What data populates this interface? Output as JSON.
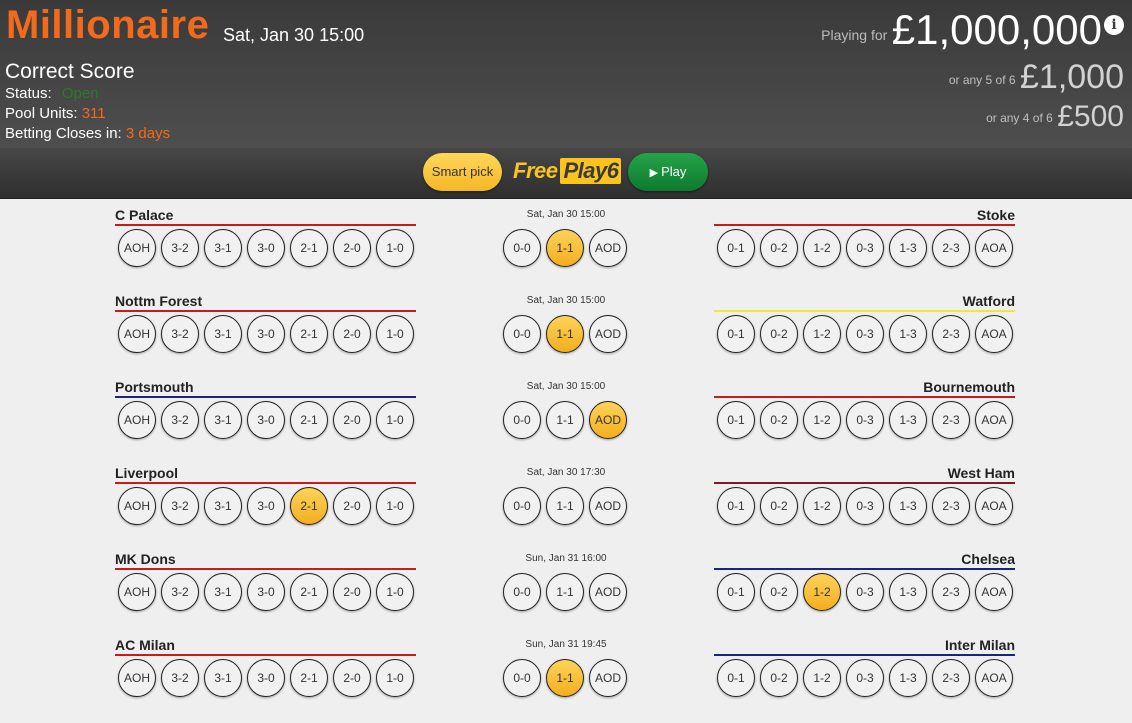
{
  "header": {
    "title": "Millionaire",
    "date": "Sat, Jan 30 15:00",
    "game_name": "Correct Score",
    "status_label": "Status:",
    "status_value": "Open",
    "pool_label": "Pool Units:",
    "pool_value": "311",
    "closes_label": "Betting Closes in:",
    "closes_value": "3 days",
    "jackpot_prefix": "Playing for",
    "jackpot_amount": "£1,000,000",
    "info_icon": "i",
    "prize2_prefix": "or any 5 of 6",
    "prize2_amount": "£1,000",
    "prize3_prefix": "or any 4 of 6",
    "prize3_amount": "£500"
  },
  "actions": {
    "smart_pick_label": "Smart pick",
    "freeplay_text": "Free",
    "freeplay_box": "Play6",
    "play_icon": "▶",
    "play_label": "Play"
  },
  "colors": {
    "brand_orange": "#f26a1b",
    "status_green": "#2a7a2a",
    "selected_gold": "#f6be2f",
    "play_green": "#15903c"
  },
  "home_options": [
    "AOH",
    "3-2",
    "3-1",
    "3-0",
    "2-1",
    "2-0",
    "1-0"
  ],
  "draw_options": [
    "0-0",
    "1-1",
    "AOD"
  ],
  "away_options": [
    "0-1",
    "0-2",
    "1-2",
    "0-3",
    "1-3",
    "2-3",
    "AOA"
  ],
  "matches": [
    {
      "home": "C Palace",
      "away": "Stoke",
      "date": "Sat, Jan 30 15:00",
      "home_color": "#c81c1c",
      "away_color": "#c81c1c",
      "selected": "1-1"
    },
    {
      "home": "Nottm Forest",
      "away": "Watford",
      "date": "Sat, Jan 30 15:00",
      "home_color": "#c81c1c",
      "away_color": "#f4e53a",
      "selected": "1-1"
    },
    {
      "home": "Portsmouth",
      "away": "Bournemouth",
      "date": "Sat, Jan 30 15:00",
      "home_color": "#1a237e",
      "away_color": "#c81c1c",
      "selected": "AOD"
    },
    {
      "home": "Liverpool",
      "away": "West Ham",
      "date": "Sat, Jan 30 17:30",
      "home_color": "#c81c1c",
      "away_color": "#7a1a2a",
      "selected": "2-1"
    },
    {
      "home": "MK Dons",
      "away": "Chelsea",
      "date": "Sun, Jan 31 16:00",
      "home_color": "#c81c1c",
      "away_color": "#1a237e",
      "selected": "1-2"
    },
    {
      "home": "AC Milan",
      "away": "Inter Milan",
      "date": "Sun, Jan 31 19:45",
      "home_color": "#c81c1c",
      "away_color": "#1a237e",
      "selected": "1-1"
    }
  ]
}
